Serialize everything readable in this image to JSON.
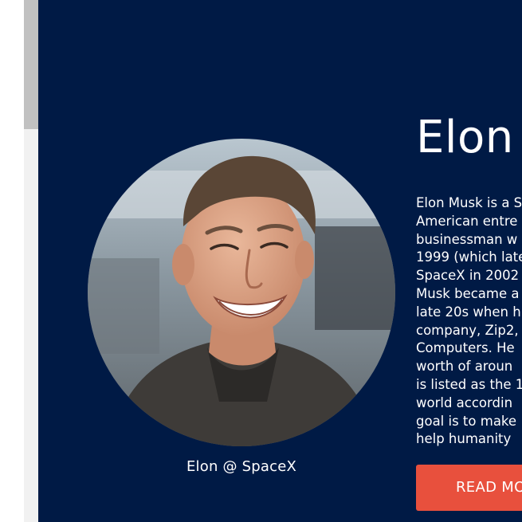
{
  "profile": {
    "title": "Elon",
    "caption": "Elon @ SpaceX",
    "bio_lines": [
      "Elon Musk is a S",
      "American entre",
      "businessman w",
      "1999 (which late",
      "SpaceX in 2002",
      "Musk became a",
      "late 20s when h",
      "company, Zip2,",
      "Computers. He",
      "worth of aroun",
      "is listed as the 1",
      "world accordin",
      "goal is to make",
      "help humanity"
    ],
    "read_more_label": "READ MO"
  },
  "colors": {
    "hero_background": "#001a45",
    "button": "#e8503d",
    "text": "#ffffff"
  }
}
